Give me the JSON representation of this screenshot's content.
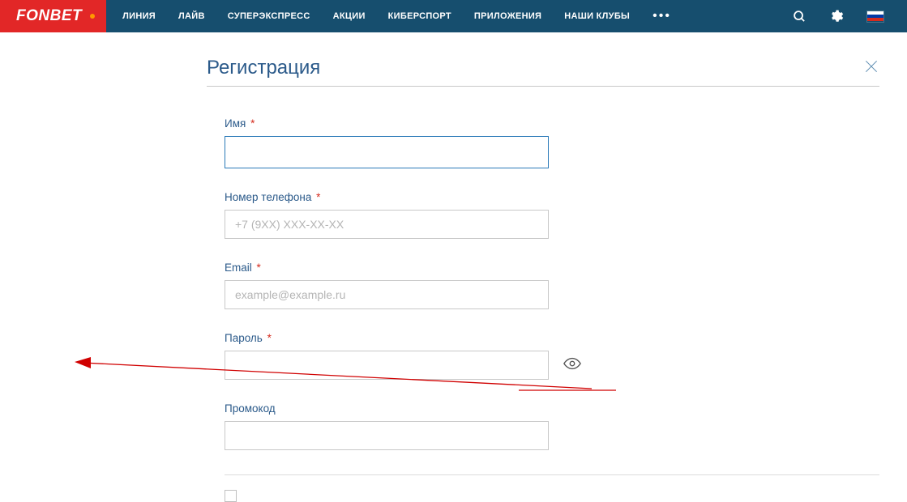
{
  "header": {
    "logo": "FONBET",
    "nav": [
      "ЛИНИЯ",
      "ЛАЙВ",
      "СУПЕРЭКСПРЕСС",
      "АКЦИИ",
      "КИБЕРСПОРТ",
      "ПРИЛОЖЕНИЯ",
      "НАШИ КЛУБЫ"
    ]
  },
  "page": {
    "title": "Регистрация"
  },
  "form": {
    "name": {
      "label": "Имя",
      "value": ""
    },
    "phone": {
      "label": "Номер телефона",
      "placeholder": "+7 (9XX) XXX-XX-XX",
      "value": ""
    },
    "email": {
      "label": "Email",
      "placeholder": "example@example.ru",
      "value": ""
    },
    "password": {
      "label": "Пароль",
      "value": ""
    },
    "promo": {
      "label": "Промокод",
      "value": ""
    }
  },
  "required_mark": "*"
}
